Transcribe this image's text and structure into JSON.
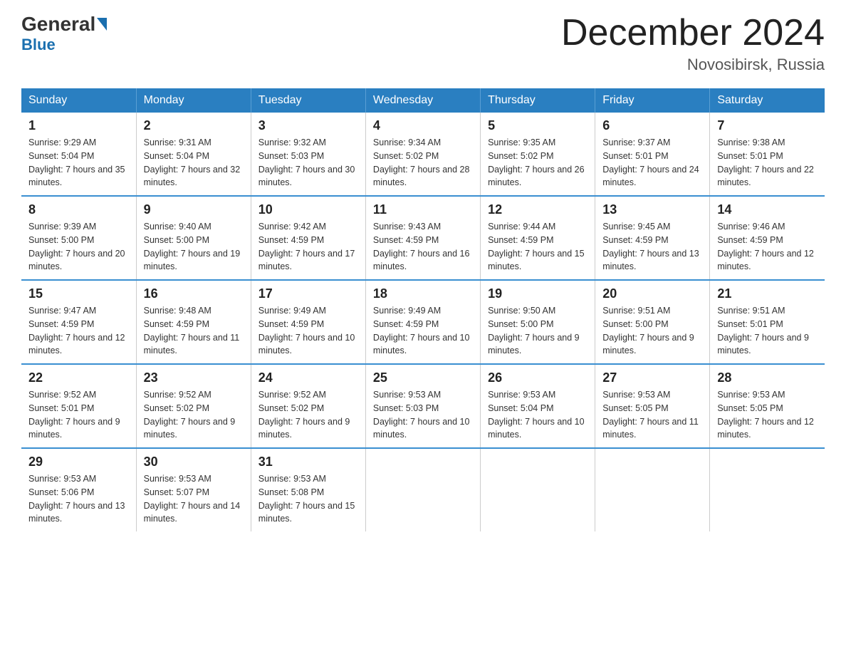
{
  "header": {
    "logo_general": "General",
    "logo_blue": "Blue",
    "month_title": "December 2024",
    "location": "Novosibirsk, Russia"
  },
  "days_of_week": [
    "Sunday",
    "Monday",
    "Tuesday",
    "Wednesday",
    "Thursday",
    "Friday",
    "Saturday"
  ],
  "weeks": [
    [
      {
        "num": "1",
        "sunrise": "9:29 AM",
        "sunset": "5:04 PM",
        "daylight": "7 hours and 35 minutes."
      },
      {
        "num": "2",
        "sunrise": "9:31 AM",
        "sunset": "5:04 PM",
        "daylight": "7 hours and 32 minutes."
      },
      {
        "num": "3",
        "sunrise": "9:32 AM",
        "sunset": "5:03 PM",
        "daylight": "7 hours and 30 minutes."
      },
      {
        "num": "4",
        "sunrise": "9:34 AM",
        "sunset": "5:02 PM",
        "daylight": "7 hours and 28 minutes."
      },
      {
        "num": "5",
        "sunrise": "9:35 AM",
        "sunset": "5:02 PM",
        "daylight": "7 hours and 26 minutes."
      },
      {
        "num": "6",
        "sunrise": "9:37 AM",
        "sunset": "5:01 PM",
        "daylight": "7 hours and 24 minutes."
      },
      {
        "num": "7",
        "sunrise": "9:38 AM",
        "sunset": "5:01 PM",
        "daylight": "7 hours and 22 minutes."
      }
    ],
    [
      {
        "num": "8",
        "sunrise": "9:39 AM",
        "sunset": "5:00 PM",
        "daylight": "7 hours and 20 minutes."
      },
      {
        "num": "9",
        "sunrise": "9:40 AM",
        "sunset": "5:00 PM",
        "daylight": "7 hours and 19 minutes."
      },
      {
        "num": "10",
        "sunrise": "9:42 AM",
        "sunset": "4:59 PM",
        "daylight": "7 hours and 17 minutes."
      },
      {
        "num": "11",
        "sunrise": "9:43 AM",
        "sunset": "4:59 PM",
        "daylight": "7 hours and 16 minutes."
      },
      {
        "num": "12",
        "sunrise": "9:44 AM",
        "sunset": "4:59 PM",
        "daylight": "7 hours and 15 minutes."
      },
      {
        "num": "13",
        "sunrise": "9:45 AM",
        "sunset": "4:59 PM",
        "daylight": "7 hours and 13 minutes."
      },
      {
        "num": "14",
        "sunrise": "9:46 AM",
        "sunset": "4:59 PM",
        "daylight": "7 hours and 12 minutes."
      }
    ],
    [
      {
        "num": "15",
        "sunrise": "9:47 AM",
        "sunset": "4:59 PM",
        "daylight": "7 hours and 12 minutes."
      },
      {
        "num": "16",
        "sunrise": "9:48 AM",
        "sunset": "4:59 PM",
        "daylight": "7 hours and 11 minutes."
      },
      {
        "num": "17",
        "sunrise": "9:49 AM",
        "sunset": "4:59 PM",
        "daylight": "7 hours and 10 minutes."
      },
      {
        "num": "18",
        "sunrise": "9:49 AM",
        "sunset": "4:59 PM",
        "daylight": "7 hours and 10 minutes."
      },
      {
        "num": "19",
        "sunrise": "9:50 AM",
        "sunset": "5:00 PM",
        "daylight": "7 hours and 9 minutes."
      },
      {
        "num": "20",
        "sunrise": "9:51 AM",
        "sunset": "5:00 PM",
        "daylight": "7 hours and 9 minutes."
      },
      {
        "num": "21",
        "sunrise": "9:51 AM",
        "sunset": "5:01 PM",
        "daylight": "7 hours and 9 minutes."
      }
    ],
    [
      {
        "num": "22",
        "sunrise": "9:52 AM",
        "sunset": "5:01 PM",
        "daylight": "7 hours and 9 minutes."
      },
      {
        "num": "23",
        "sunrise": "9:52 AM",
        "sunset": "5:02 PM",
        "daylight": "7 hours and 9 minutes."
      },
      {
        "num": "24",
        "sunrise": "9:52 AM",
        "sunset": "5:02 PM",
        "daylight": "7 hours and 9 minutes."
      },
      {
        "num": "25",
        "sunrise": "9:53 AM",
        "sunset": "5:03 PM",
        "daylight": "7 hours and 10 minutes."
      },
      {
        "num": "26",
        "sunrise": "9:53 AM",
        "sunset": "5:04 PM",
        "daylight": "7 hours and 10 minutes."
      },
      {
        "num": "27",
        "sunrise": "9:53 AM",
        "sunset": "5:05 PM",
        "daylight": "7 hours and 11 minutes."
      },
      {
        "num": "28",
        "sunrise": "9:53 AM",
        "sunset": "5:05 PM",
        "daylight": "7 hours and 12 minutes."
      }
    ],
    [
      {
        "num": "29",
        "sunrise": "9:53 AM",
        "sunset": "5:06 PM",
        "daylight": "7 hours and 13 minutes."
      },
      {
        "num": "30",
        "sunrise": "9:53 AM",
        "sunset": "5:07 PM",
        "daylight": "7 hours and 14 minutes."
      },
      {
        "num": "31",
        "sunrise": "9:53 AM",
        "sunset": "5:08 PM",
        "daylight": "7 hours and 15 minutes."
      },
      {
        "num": "",
        "sunrise": "",
        "sunset": "",
        "daylight": ""
      },
      {
        "num": "",
        "sunrise": "",
        "sunset": "",
        "daylight": ""
      },
      {
        "num": "",
        "sunrise": "",
        "sunset": "",
        "daylight": ""
      },
      {
        "num": "",
        "sunrise": "",
        "sunset": "",
        "daylight": ""
      }
    ]
  ]
}
